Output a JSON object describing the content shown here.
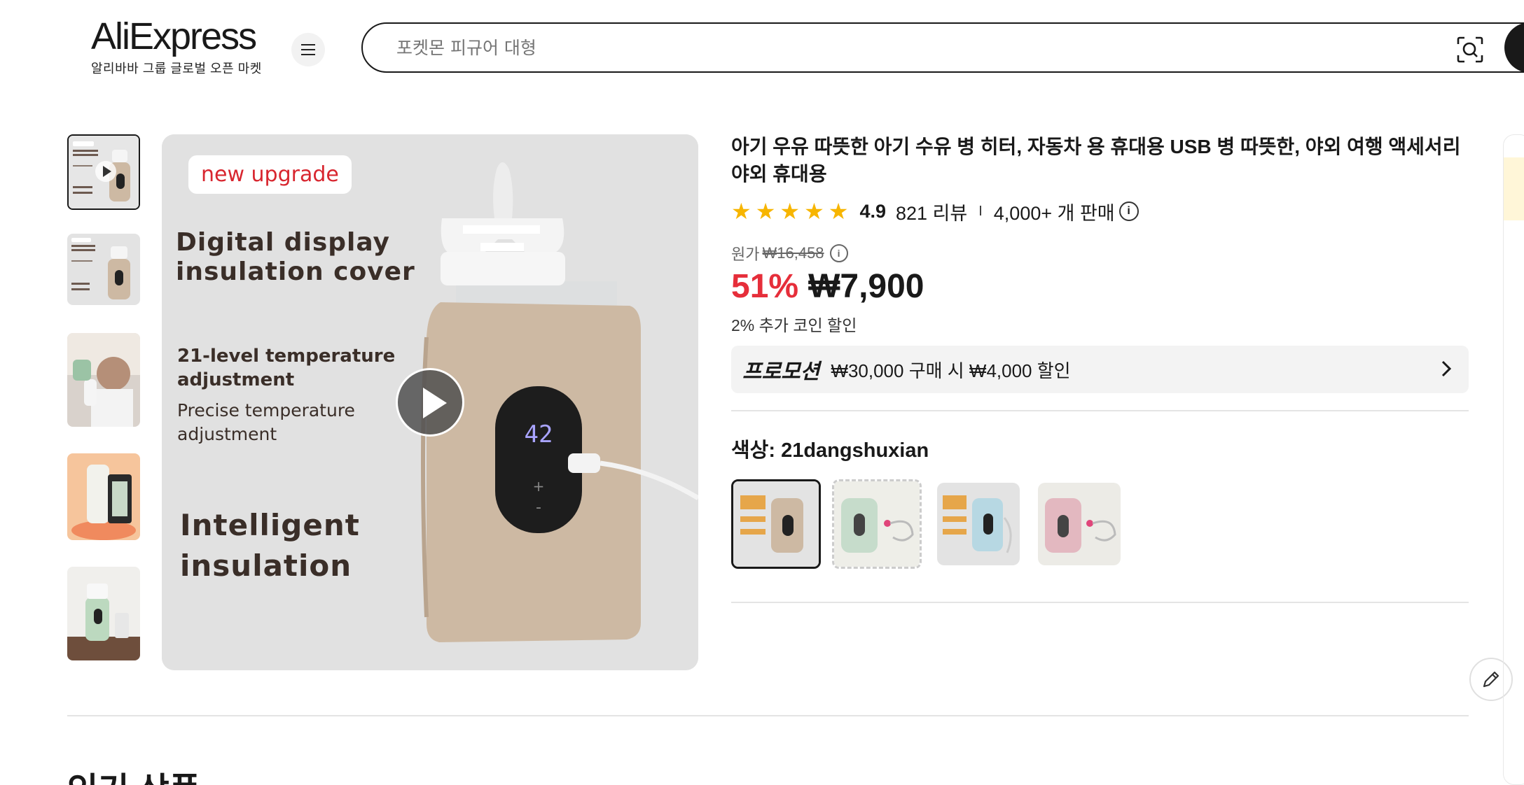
{
  "header": {
    "brand": "AliExpress",
    "tagline": "알리바바 그룹 글로벌 오픈 마켓",
    "search_placeholder": "포켓몬 피규어 대형"
  },
  "main_image": {
    "badge": "new upgrade",
    "heading1": "Digital display",
    "heading2": "insulation cover",
    "feature1a": "21-level temperature",
    "feature1b": "adjustment",
    "feature2a": "Precise temperature",
    "feature2b": "adjustment",
    "feature3a": "Intelligent",
    "feature3b": "insulation",
    "display_value": "42"
  },
  "product": {
    "title": "아기 우유 따뜻한 아기 수유 병 히터, 자동차 용 휴대용 USB 병 따뜻한, 야외 여행 액세서리 야외 휴대용",
    "rating": "4.9",
    "reviews": "821 리뷰",
    "separator": "I",
    "sold": "4,000+ 개 판매",
    "original_label": "원가",
    "original_price": "₩16,458",
    "discount": "51%",
    "price": "₩7,900",
    "coin_discount": "2% 추가 코인 할인",
    "promo_title": "프로모션",
    "promo_text": "₩30,000 구매 시 ₩4,000 할인",
    "color_label": "색상: 21dangshuxian"
  },
  "footer": {
    "section_title": "인기 상품"
  },
  "colors": {
    "accent_red": "#e62e3a",
    "star_yellow": "#f7b500",
    "beige": "#cdb9a3",
    "mint": "#c6dccb",
    "blue": "#b7d8e3",
    "pink": "#e3b8c0"
  }
}
